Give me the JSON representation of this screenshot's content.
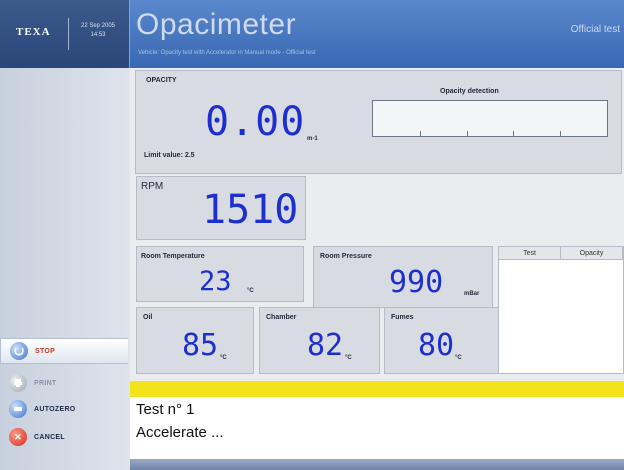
{
  "header": {
    "logo_text": "TEXA",
    "date": "22 Sep 2005",
    "time": "14:53",
    "app_title": "Opacimeter",
    "right_text": "Official test",
    "subtitle": "Vehicle: Opacity test with Accelerator in Manual mode - Official test"
  },
  "sidebar": {
    "stop_label": "STOP",
    "print_label": "PRINT",
    "autozero_label": "AUTOZERO",
    "cancel_label": "CANCEL"
  },
  "opacity": {
    "label": "OPACITY",
    "value": "0.00",
    "unit": "m-1",
    "limit": "Limit value: 2.5",
    "detection_label": "Opacity detection"
  },
  "rpm": {
    "label": "RPM",
    "value": "1510"
  },
  "room_temperature": {
    "label": "Room Temperature",
    "value": "23",
    "unit": "°C"
  },
  "room_pressure": {
    "label": "Room Pressure",
    "value": "990",
    "unit": "mBar"
  },
  "oil": {
    "label": "Oil",
    "value": "85",
    "unit": "°C"
  },
  "chamber": {
    "label": "Chamber",
    "value": "82",
    "unit": "°C"
  },
  "fumes": {
    "label": "Fumes",
    "value": "80",
    "unit": "°C"
  },
  "table": {
    "columns": [
      "Test",
      "Opacity"
    ]
  },
  "message": {
    "line1": "Test n° 1",
    "line2": "Accelerate ..."
  },
  "colors": {
    "title_blue": "#3868b3",
    "digit_blue": "#1e2fd0",
    "status_yellow": "#f2e31a"
  },
  "icons": {
    "stop": "stop-icon",
    "print": "print-icon",
    "autozero": "autozero-icon",
    "cancel": "cancel-icon"
  }
}
